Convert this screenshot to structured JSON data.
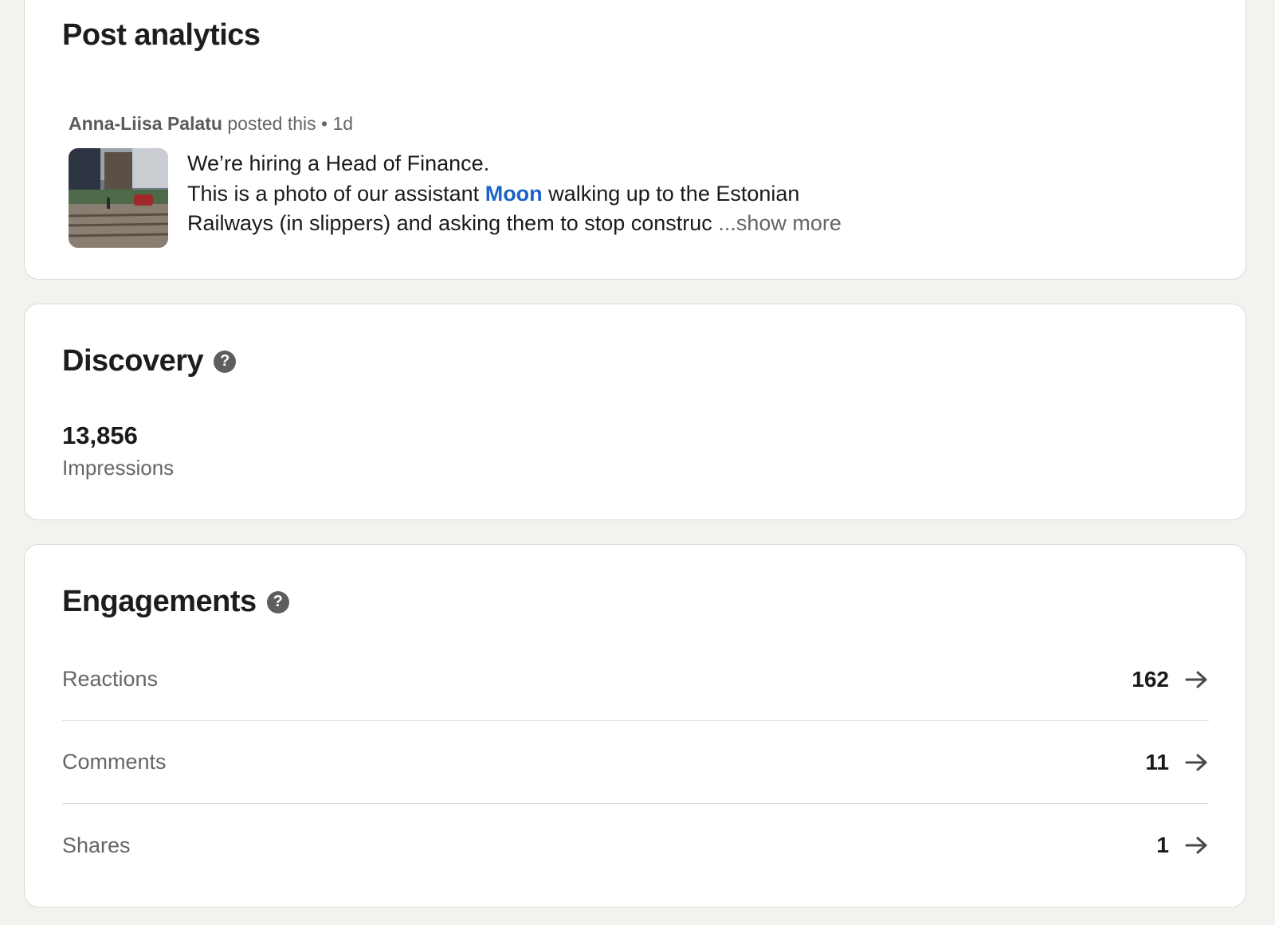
{
  "post_card": {
    "title": "Post analytics",
    "author": "Anna-Liisa Palatu",
    "posted_text": "posted this",
    "separator": "•",
    "age": "1d",
    "text_line1": "We’re hiring a Head of Finance.",
    "text_line2_pre": "This is a photo of our assistant",
    "mention": "Moon",
    "text_line2_post": "walking up to the Estonian",
    "text_line3": "Railways (in slippers) and asking them to stop construc",
    "show_more": "...show more"
  },
  "discovery": {
    "title": "Discovery",
    "help_icon": "?",
    "impressions_value": "13,856",
    "impressions_label": "Impressions"
  },
  "engagements": {
    "title": "Engagements",
    "help_icon": "?",
    "rows": [
      {
        "label": "Reactions",
        "value": "162"
      },
      {
        "label": "Comments",
        "value": "11"
      },
      {
        "label": "Shares",
        "value": "1"
      }
    ]
  },
  "colors": {
    "background": "#f3f2ef",
    "card": "#ffffff",
    "mention_link": "#1a64c8",
    "secondary_text": "#666666"
  }
}
